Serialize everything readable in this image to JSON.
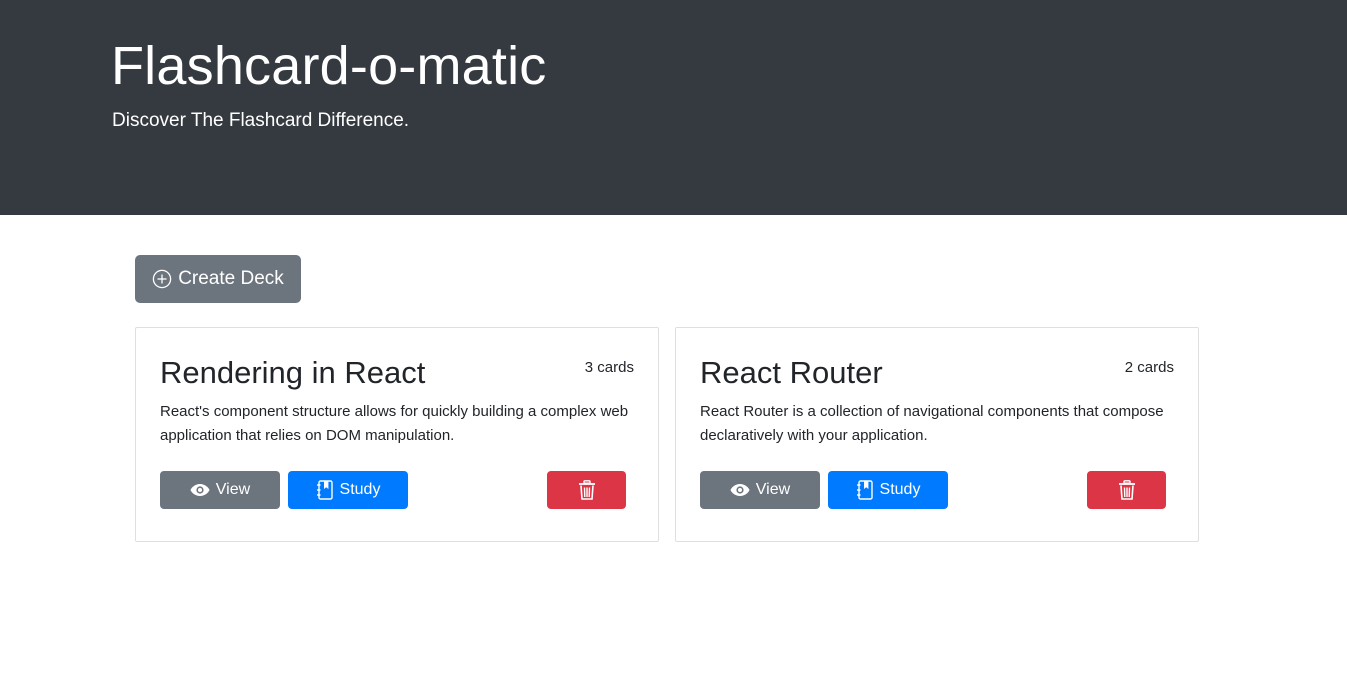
{
  "header": {
    "title": "Flashcard-o-matic",
    "subtitle": "Discover The Flashcard Difference."
  },
  "actions": {
    "create_deck_label": "Create Deck"
  },
  "decks": [
    {
      "name": "Rendering in React",
      "count": "3 cards",
      "description": "React's component structure allows for quickly building a complex web application that relies on DOM manipulation.",
      "view_label": "View",
      "study_label": "Study"
    },
    {
      "name": "React Router",
      "count": "2 cards",
      "description": "React Router is a collection of navigational components that compose declaratively with your application.",
      "view_label": "View",
      "study_label": "Study"
    }
  ],
  "icons": {
    "create": "plus-circle-icon",
    "view": "eye-icon",
    "study": "journal-bookmark-icon",
    "delete": "trash-icon"
  },
  "colors": {
    "header_bg": "#343a40",
    "secondary": "#6c757d",
    "primary": "#007bff",
    "danger": "#dc3545"
  }
}
